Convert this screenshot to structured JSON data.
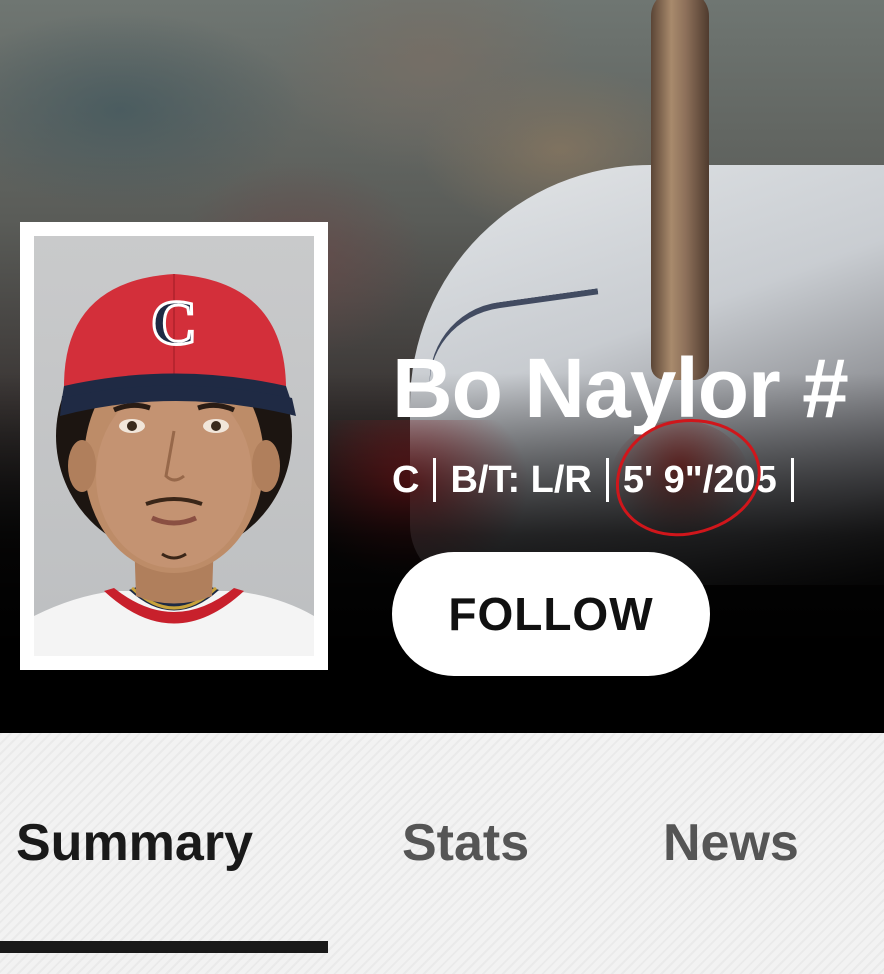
{
  "player": {
    "name": "Bo Naylor #",
    "position": "C",
    "bats_throws": "B/T: L/R",
    "height": "5' 9\"",
    "weight_sep": "/",
    "weight": "205",
    "cap_logo": "C"
  },
  "follow_label": "FOLLOW",
  "tabs": [
    {
      "label": "Summary",
      "active": true
    },
    {
      "label": "Stats",
      "active": false
    },
    {
      "label": "News",
      "active": false
    }
  ],
  "colors": {
    "annotation": "#d0161b",
    "cap_red": "#d32f3a",
    "cap_navy": "#1f2a44"
  }
}
